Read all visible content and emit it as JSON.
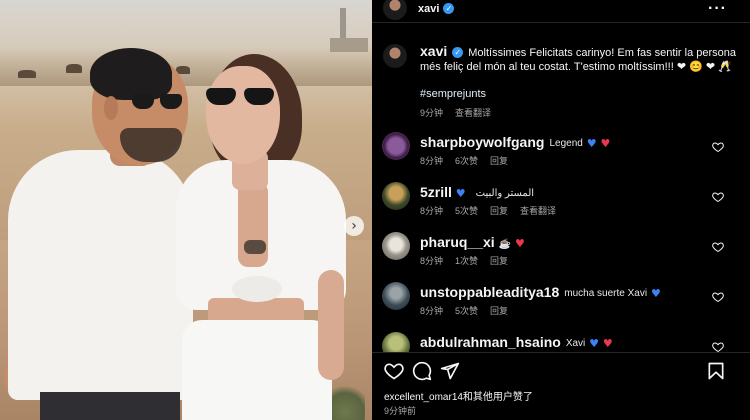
{
  "post": {
    "author": "xavi",
    "caption": "Moltíssimes Felicitats carinyo! Em fas sentir la persona més feliç del món al teu costat. T'estimo moltíssim!!!",
    "caption_emojis": "❤ 😊 ❤ 🥂",
    "hashtag": "#semprejunts",
    "time": "9分钟",
    "see_translation": "查看翻译",
    "more_icon": "more-options-icon",
    "likes_text": "excellent_omar14和其他用户赞了",
    "time_ago": "9分钟前"
  },
  "comments": [
    {
      "user": "sharpboywolfgang",
      "text": "Legend",
      "hearts": [
        "blue",
        "red"
      ],
      "time": "8分钟",
      "likes": "6次赞",
      "reply": "回复",
      "translate": ""
    },
    {
      "user": "5zrill",
      "text": "المستر والبيت",
      "hearts": [
        "blue"
      ],
      "time": "8分钟",
      "likes": "5次赞",
      "reply": "回复",
      "translate": "查看翻译"
    },
    {
      "user": "pharuq__xi",
      "text": "",
      "hearts": [
        "red"
      ],
      "time": "8分钟",
      "likes": "1次赞",
      "reply": "回复",
      "translate": ""
    },
    {
      "user": "unstoppableaditya18",
      "text": "mucha suerte Xavi",
      "hearts": [
        "blue"
      ],
      "time": "8分钟",
      "likes": "5次赞",
      "reply": "回复",
      "translate": ""
    },
    {
      "user": "abdulrahman_hsaino",
      "text": "Xavi",
      "hearts": [
        "blue",
        "red"
      ],
      "time": "",
      "likes": "",
      "reply": "",
      "translate": ""
    }
  ],
  "icons": {
    "like": "heart-icon",
    "comment": "comment-icon",
    "share": "send-icon",
    "save": "bookmark-icon",
    "next": "chevron-right-icon"
  },
  "colors": {
    "background": "#000000",
    "verified": "#3897f0",
    "heart_red": "#e8374e",
    "heart_blue": "#3b82f6",
    "muted_text": "#a8a8a8"
  }
}
